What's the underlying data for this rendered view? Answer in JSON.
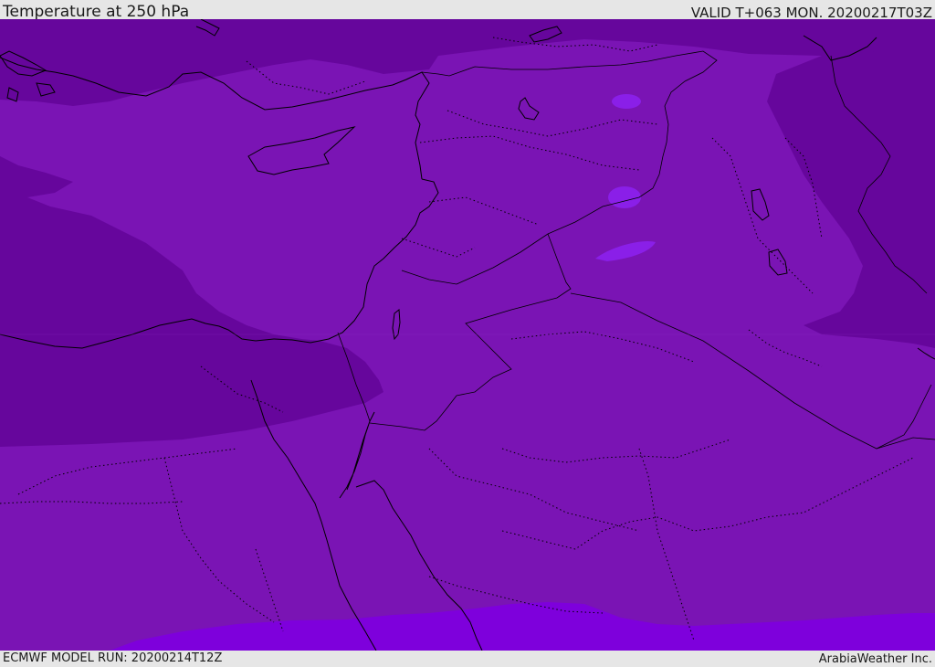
{
  "header": {
    "title": "Temperature at 250 hPa",
    "valid": "VALID T+063 MON. 20200217T03Z"
  },
  "footer": {
    "model_run": "ECMWF MODEL RUN: 20200214T12Z",
    "credit": "ArabiaWeather Inc."
  },
  "map": {
    "colors": {
      "base": "#7a14b4",
      "cold": "#66069c",
      "warm": "#7e00dc",
      "warm_patch": "#8a1fe8",
      "line": "#000000"
    }
  }
}
